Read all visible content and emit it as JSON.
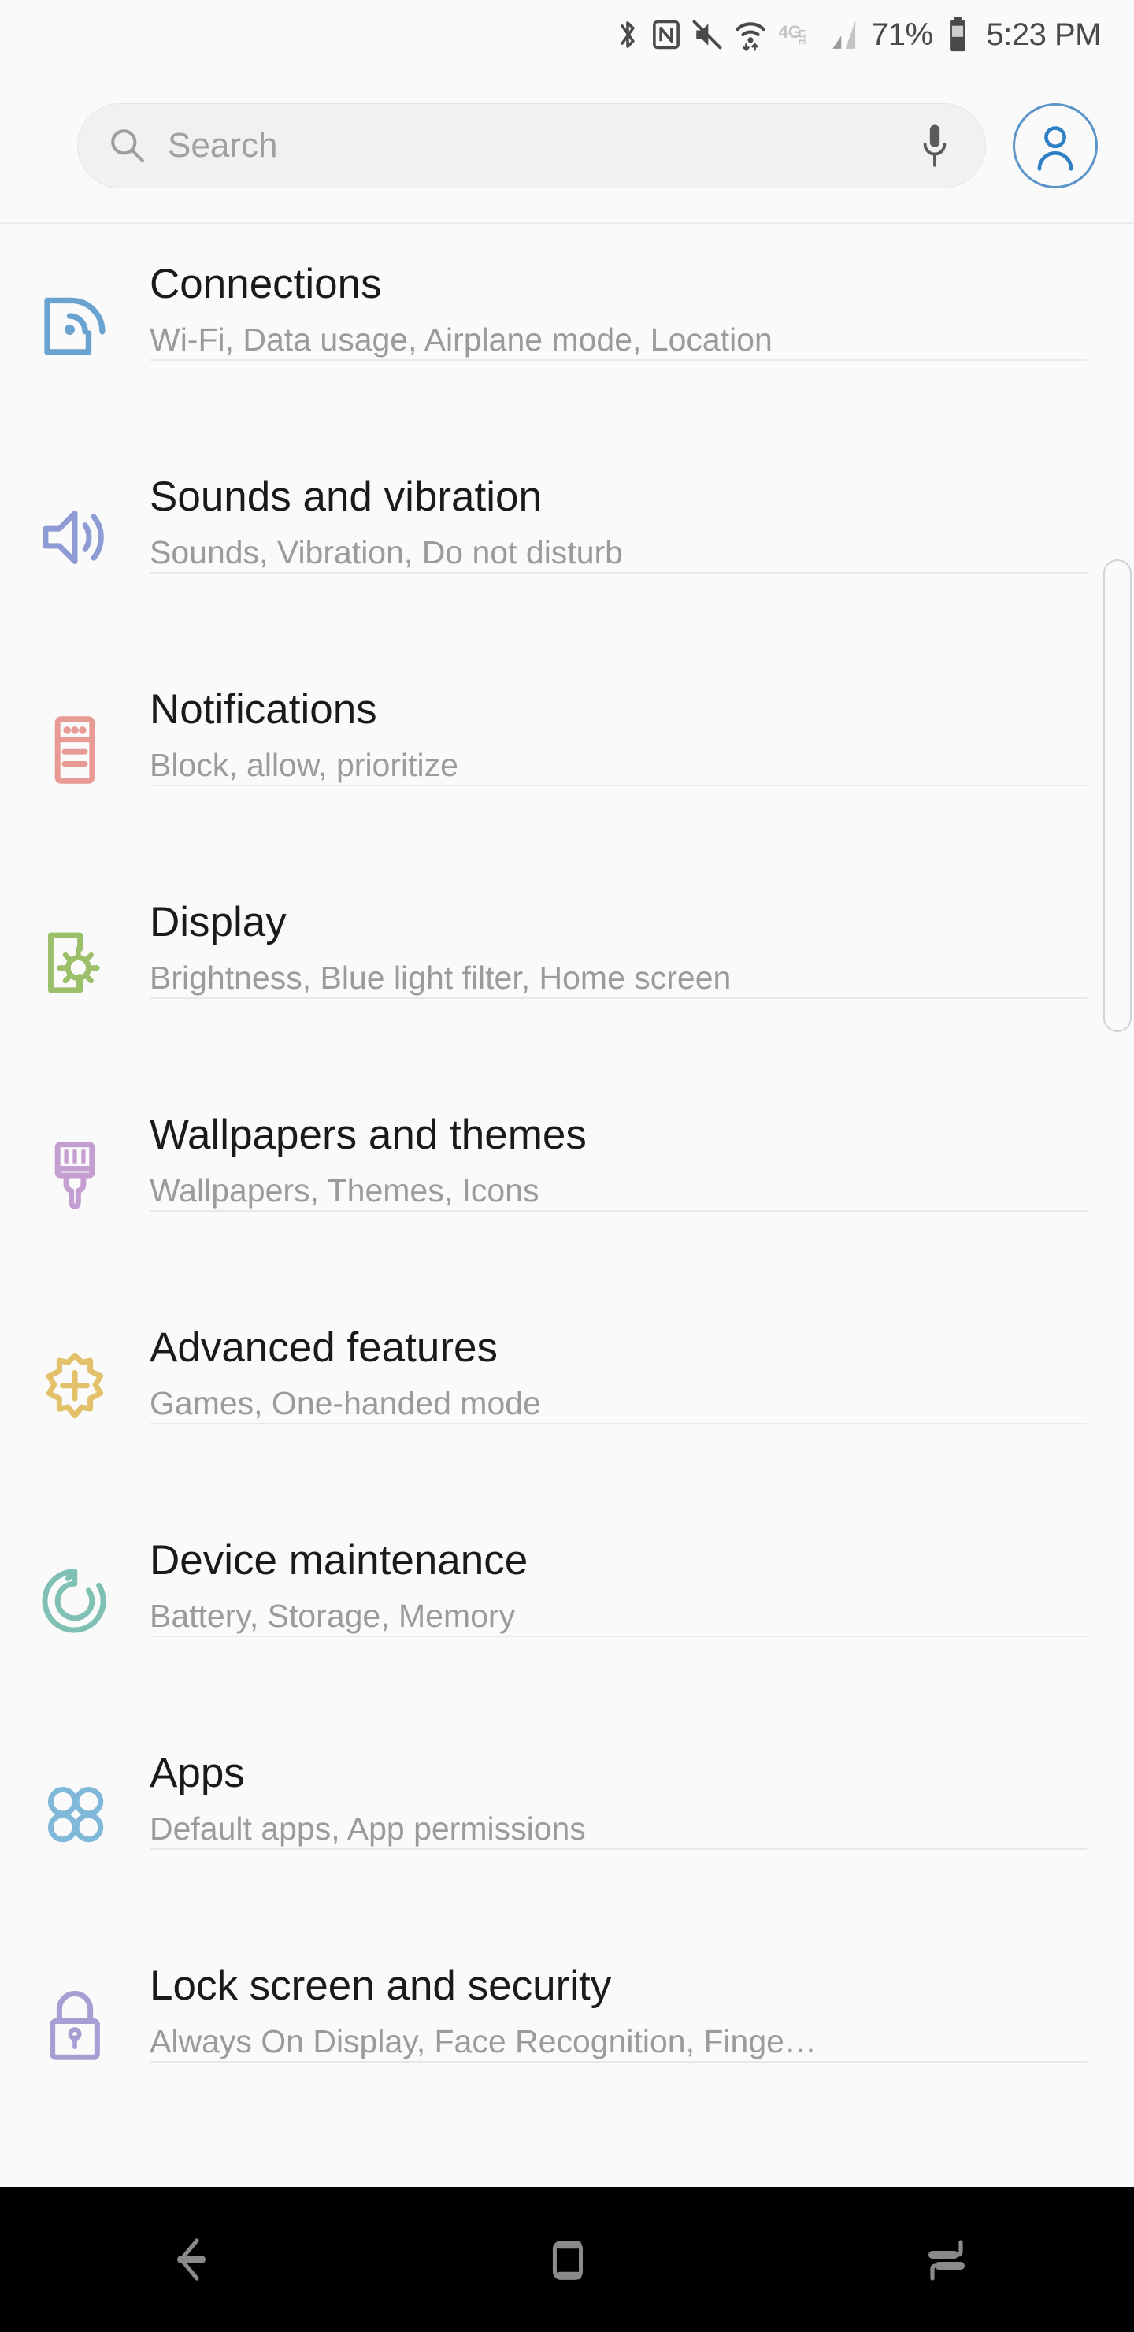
{
  "status_bar": {
    "icons": [
      "bluetooth-icon",
      "nfc-icon",
      "mute-icon",
      "wifi-icon",
      "4glte-icon",
      "signal-icon",
      "battery-icon"
    ],
    "network_label": "4G",
    "network_sublabel": "LTE",
    "battery_percent": "71%",
    "clock": "5:23 PM"
  },
  "search": {
    "placeholder": "Search",
    "search_icon": "magnifier-icon",
    "mic_icon": "microphone-icon",
    "account_icon": "account-circle-icon",
    "accent_color": "#5a94c8"
  },
  "settings_list": [
    {
      "title": "Connections",
      "subtitle": "Wi-Fi, Data usage, Airplane mode, Location",
      "icon": "connections-icon",
      "color": "#6aa3d0"
    },
    {
      "title": "Sounds and vibration",
      "subtitle": "Sounds, Vibration, Do not disturb",
      "icon": "speaker-icon",
      "color": "#8e9bd4"
    },
    {
      "title": "Notifications",
      "subtitle": "Block, allow, prioritize",
      "icon": "notifications-icon",
      "color": "#e89a94"
    },
    {
      "title": "Display",
      "subtitle": "Brightness, Blue light filter, Home screen",
      "icon": "display-brightness-icon",
      "color": "#9cbf6a"
    },
    {
      "title": "Wallpapers and themes",
      "subtitle": "Wallpapers, Themes, Icons",
      "icon": "paintbrush-icon",
      "color": "#c49ed0"
    },
    {
      "title": "Advanced features",
      "subtitle": "Games, One-handed mode",
      "icon": "advanced-gear-icon",
      "color": "#e3c06a"
    },
    {
      "title": "Device maintenance",
      "subtitle": "Battery, Storage, Memory",
      "icon": "refresh-circle-icon",
      "color": "#7fbfb4"
    },
    {
      "title": "Apps",
      "subtitle": "Default apps, App permissions",
      "icon": "apps-grid-icon",
      "color": "#7fb8d8"
    },
    {
      "title": "Lock screen and security",
      "subtitle": "Always On Display, Face Recognition, Finge…",
      "icon": "padlock-icon",
      "color": "#a99ed4"
    }
  ],
  "nav_bar": {
    "back": "back-arrow-icon",
    "home": "home-square-icon",
    "recents": "recents-icon"
  }
}
